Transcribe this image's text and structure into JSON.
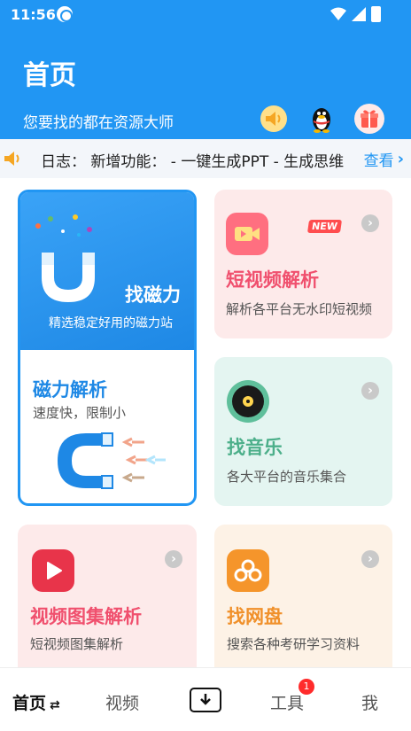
{
  "status_bar": {
    "time": "11:56"
  },
  "header": {
    "title": "首页",
    "subtitle": "您要找的都在资源大师"
  },
  "notice": {
    "text": "日志：  新增功能：    - 一键生成PPT - 生成思维",
    "link_label": "查看"
  },
  "cards": {
    "magnet": {
      "title": "找磁力",
      "desc": "精选稳定好用的磁力站"
    },
    "magnet_parse": {
      "title": "磁力解析",
      "desc": "速度快，限制小"
    },
    "video_parse": {
      "title": "短视频解析",
      "desc": "解析各平台无水印短视频",
      "badge": "NEW"
    },
    "music": {
      "title": "找音乐",
      "desc": "各大平台的音乐集合"
    },
    "album_parse": {
      "title": "视频图集解析",
      "desc": "短视频图集解析"
    },
    "netdisk": {
      "title": "找网盘",
      "desc": "搜索各种考研学习资料"
    }
  },
  "bottom_nav": {
    "home": "首页",
    "video": "视频",
    "tools": "工具",
    "tools_badge": "1",
    "me": "我"
  },
  "icons": {
    "header_speaker": "speaker-icon",
    "header_qq": "penguin-icon",
    "header_gift": "gift-icon",
    "download": "download-icon"
  },
  "colors": {
    "primary": "#2196f3",
    "video_title": "#f0506e",
    "music_title": "#4caf8a",
    "netdisk_title": "#f0902a",
    "badge_red": "#ff2b2b"
  }
}
